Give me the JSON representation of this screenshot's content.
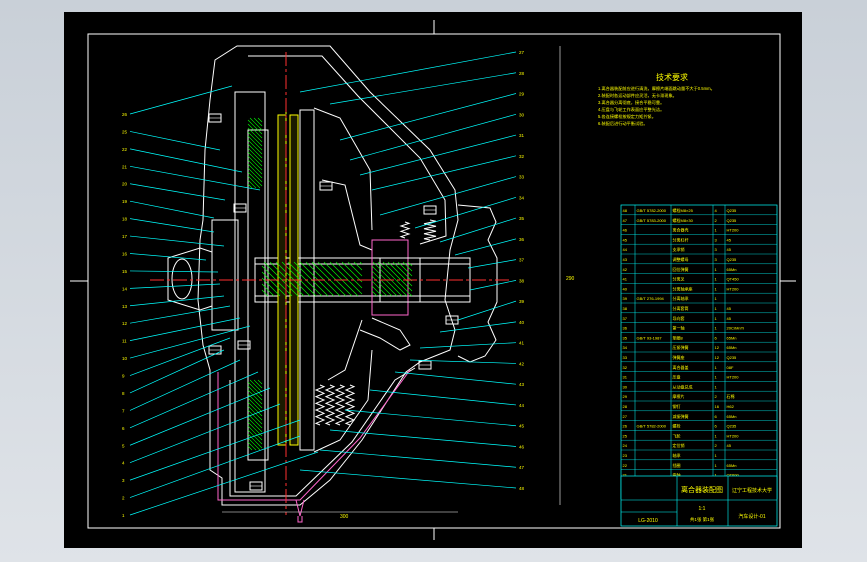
{
  "tech_title": "技术要求",
  "tech_notes": [
    "1.离合器装配前应进行清洗，摩擦片端面跳动量不大于0.5mm。",
    "2.装配时各运动部件应灵活，无卡滞现象。",
    "3.离合器分离彻底，接合平稳可靠。",
    "4.压盘与飞轮工作表面应平整光洁。",
    "5.各连接螺栓按规定力矩拧紧。",
    "6.装配后进行动平衡试验。"
  ],
  "left_labels": [
    "26",
    "25",
    "22",
    "21",
    "20",
    "19",
    "18",
    "17",
    "16",
    "15",
    "14",
    "13",
    "12",
    "11",
    "10",
    "9",
    "8",
    "7",
    "6",
    "5",
    "4",
    "3",
    "2",
    "1"
  ],
  "right_labels": [
    "27",
    "28",
    "29",
    "30",
    "31",
    "32",
    "33",
    "34",
    "35",
    "36",
    "37",
    "38",
    "39",
    "40",
    "41",
    "42",
    "43",
    "44",
    "45",
    "46",
    "47",
    "48"
  ],
  "bom_rows": [
    [
      "48",
      "GB/T 5782-2000",
      "螺栓M8×25",
      "4",
      "Q235"
    ],
    [
      "47",
      "GB/T 5783-2000",
      "螺栓M8×30",
      "2",
      "Q235"
    ],
    [
      "46",
      "",
      "离合器壳",
      "1",
      "HT200"
    ],
    [
      "45",
      "",
      "分离杠杆",
      "3",
      "45"
    ],
    [
      "44",
      "",
      "支承销",
      "3",
      "45"
    ],
    [
      "43",
      "",
      "调整螺母",
      "3",
      "Q235"
    ],
    [
      "42",
      "",
      "回位弹簧",
      "1",
      "65Mn"
    ],
    [
      "41",
      "",
      "分离叉",
      "1",
      "QT450"
    ],
    [
      "40",
      "",
      "分离轴承座",
      "1",
      "HT200"
    ],
    [
      "39",
      "GB/T 276-1994",
      "分离轴承",
      "1",
      ""
    ],
    [
      "38",
      "",
      "分离套筒",
      "1",
      "45"
    ],
    [
      "37",
      "",
      "导向套",
      "1",
      "45"
    ],
    [
      "36",
      "",
      "第一轴",
      "1",
      "20CrMnTi"
    ],
    [
      "35",
      "GB/T 93-1987",
      "垫圈8",
      "6",
      "65Mn"
    ],
    [
      "34",
      "",
      "压紧弹簧",
      "12",
      "65Mn"
    ],
    [
      "33",
      "",
      "弹簧座",
      "12",
      "Q235"
    ],
    [
      "32",
      "",
      "离合器盖",
      "1",
      "08F"
    ],
    [
      "31",
      "",
      "压盘",
      "1",
      "HT200"
    ],
    [
      "30",
      "",
      "从动盘总成",
      "1",
      ""
    ],
    [
      "29",
      "",
      "摩擦片",
      "2",
      "石棉"
    ],
    [
      "28",
      "",
      "铆钉",
      "16",
      "H62"
    ],
    [
      "27",
      "",
      "减振弹簧",
      "6",
      "65Mn"
    ],
    [
      "26",
      "GB/T 5782-2000",
      "螺栓",
      "6",
      "Q235"
    ],
    [
      "25",
      "",
      "飞轮",
      "1",
      "HT200"
    ],
    [
      "24",
      "",
      "定位销",
      "2",
      "45"
    ],
    [
      "23",
      "",
      "轴承",
      "1",
      ""
    ],
    [
      "22",
      "",
      "挡圈",
      "1",
      "65Mn"
    ],
    [
      "21",
      "",
      "曲轴",
      "1",
      "QT600"
    ]
  ],
  "bom_header": [
    "序号",
    "代号",
    "名称",
    "数量",
    "材料"
  ],
  "title_block": {
    "drawing_name": "离合器装配图",
    "school": "辽宁工程技术大学",
    "drawing_no": "汽车设计-01",
    "scale": "1:1",
    "sheet": "共1张 第1张",
    "code": "LG-2010"
  },
  "dimensions": {
    "height_label": "290",
    "width_label": "300"
  },
  "colors": {
    "background": "#000000",
    "outline": "#ffffff",
    "leader": "#00ffff",
    "text": "#ffff00",
    "friction": "#ffff00",
    "hatch": "#00ff00",
    "center": "#ff3030",
    "pink": "#ff66cc"
  }
}
